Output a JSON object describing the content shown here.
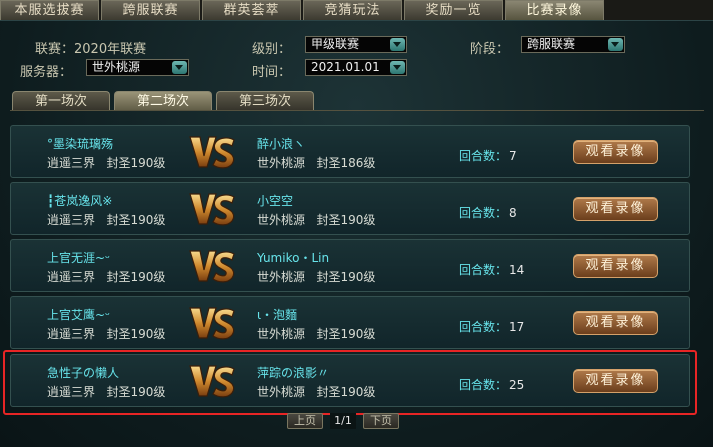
{
  "top_tabs": [
    "本服选拔赛",
    "跨服联赛",
    "群英荟萃",
    "竞猜玩法",
    "奖励一览",
    "比赛录像"
  ],
  "filters": {
    "league_label": "联赛：2020年联赛",
    "level_label": "级别：",
    "level_value": "甲级联赛",
    "stage_label": "阶段：",
    "stage_value": "跨服联赛",
    "server_label": "服务器：",
    "server_value": "世外桃源",
    "time_label": "时间：",
    "time_value": "2021.01.01"
  },
  "sub_tabs": [
    "第一场次",
    "第二场次",
    "第三场次"
  ],
  "rounds_label": "回合数：",
  "watch_label": "观看录像",
  "matches": [
    {
      "p1": "°墨染琉璃殇",
      "p1_server": "逍遥三界",
      "p1_level": "封圣190级",
      "p2": "醉小浪ヽ",
      "p2_server": "世外桃源",
      "p2_level": "封圣186级",
      "rounds": "7"
    },
    {
      "p1": "┇苍岚逸风※",
      "p1_server": "逍遥三界",
      "p1_level": "封圣190级",
      "p2": "小空空",
      "p2_server": "世外桃源",
      "p2_level": "封圣190级",
      "rounds": "8"
    },
    {
      "p1": "上官无涯~ᵕ",
      "p1_server": "逍遥三界",
      "p1_level": "封圣190级",
      "p2": "Yumiko・Lin",
      "p2_server": "世外桃源",
      "p2_level": "封圣190级",
      "rounds": "14"
    },
    {
      "p1": "上官艾鹰~ᵕ",
      "p1_server": "逍遥三界",
      "p1_level": "封圣190级",
      "p2": "ι・泡麵",
      "p2_server": "世外桃源",
      "p2_level": "封圣190级",
      "rounds": "17"
    },
    {
      "p1": "急性子の懒人",
      "p1_server": "逍遥三界",
      "p1_level": "封圣190级",
      "p2": "萍踪の浪影〃",
      "p2_server": "世外桃源",
      "p2_level": "封圣190级",
      "rounds": "25"
    }
  ],
  "pager": {
    "prev": "上页",
    "info": "1/1",
    "next": "下页"
  }
}
